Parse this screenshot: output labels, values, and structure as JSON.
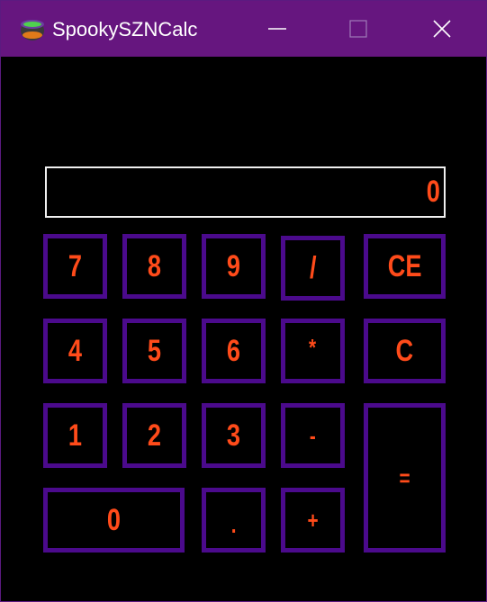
{
  "window": {
    "title": "SpookySZNCalc",
    "controls": {
      "minimize": "minimize",
      "maximize": "maximize",
      "close": "close"
    }
  },
  "display": {
    "value": "0"
  },
  "keys": {
    "k7": "7",
    "k8": "8",
    "k9": "9",
    "div": "/",
    "ce": "CE",
    "k4": "4",
    "k5": "5",
    "k6": "6",
    "mul": "*",
    "c": "C",
    "k1": "1",
    "k2": "2",
    "k3": "3",
    "sub": "-",
    "eq": "=",
    "k0": "0",
    "dot": ".",
    "add": "+"
  },
  "colors": {
    "titlebar": "#66167f",
    "key_border": "#4b0a8c",
    "key_text": "#ff4b1a",
    "background": "#000000",
    "display_border": "#f0f0f0"
  },
  "icons": {
    "app": "cauldron-icon",
    "minimize": "minimize-icon",
    "maximize": "maximize-icon",
    "close": "close-icon"
  }
}
